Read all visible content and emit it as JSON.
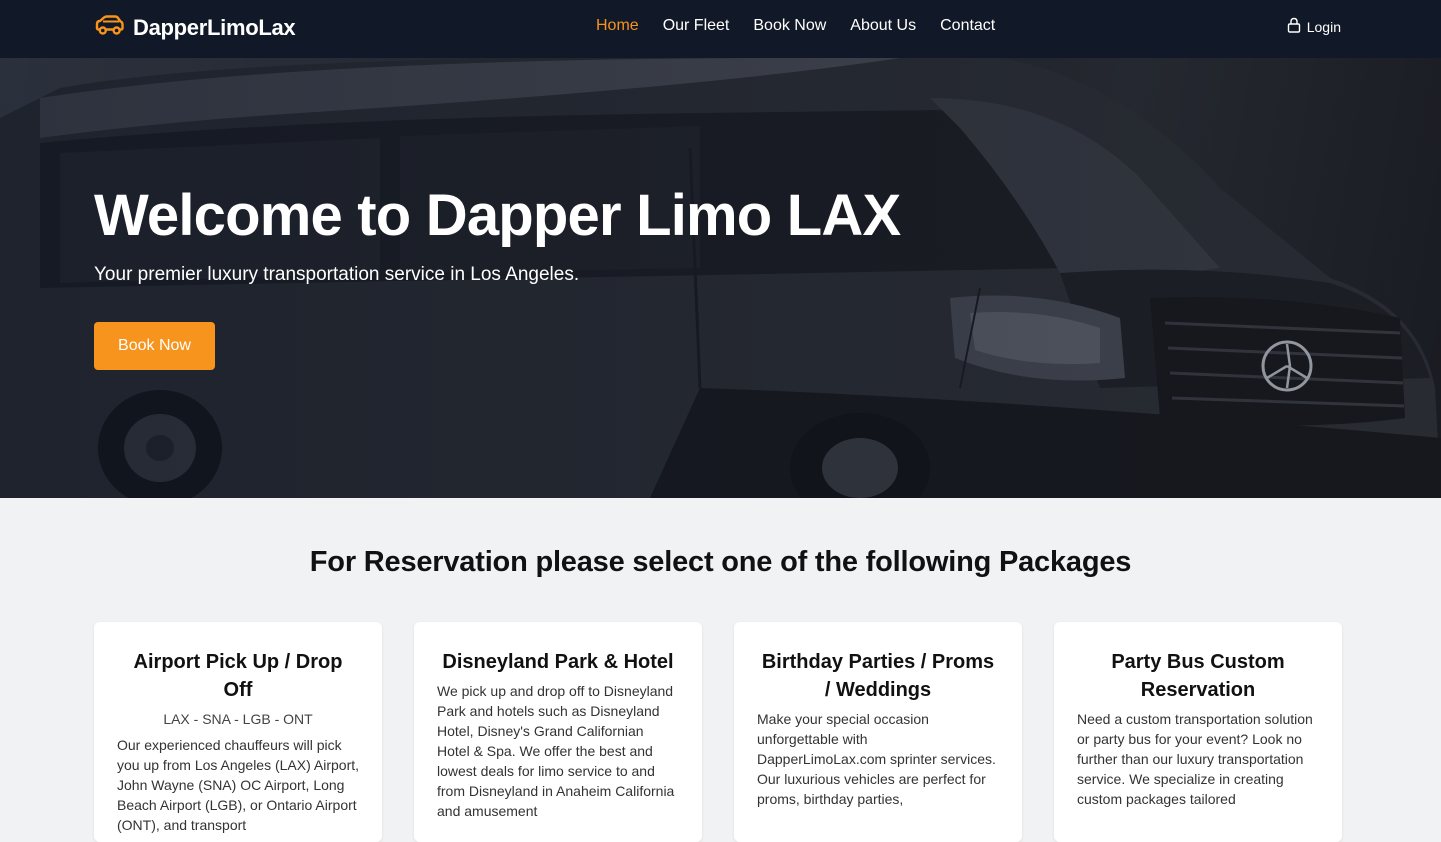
{
  "navbar": {
    "brand": "DapperLimoLax",
    "links": [
      "Home",
      "Our Fleet",
      "Book Now",
      "About Us",
      "Contact"
    ],
    "active": "Home",
    "login": "Login",
    "accent": "#f7941d",
    "brand_icon": "car-icon",
    "login_icon": "lock-icon"
  },
  "hero": {
    "title": "Welcome to Dapper Limo LAX",
    "subtitle": "Your premier luxury transportation service in Los Angeles.",
    "button": "Book Now"
  },
  "packages": {
    "heading": "For Reservation please select one of the following Packages",
    "cards": [
      {
        "title": "Airport Pick Up / Drop Off",
        "subtitle": "LAX - SNA - LGB - ONT",
        "description": "Our experienced chauffeurs will pick you up from Los Angeles (LAX) Airport, John Wayne (SNA) OC Airport, Long Beach Airport (LGB), or Ontario Airport (ONT), and transport"
      },
      {
        "title": "Disneyland Park & Hotel",
        "subtitle": "",
        "description": "We pick up and drop off to Disneyland Park and hotels such as Disneyland Hotel, Disney's Grand Californian Hotel & Spa. We offer the best and lowest deals for limo service to and from Disneyland in Anaheim California and amusement"
      },
      {
        "title": "Birthday Parties / Proms / Weddings",
        "subtitle": "",
        "description": "Make your special occasion unforgettable with DapperLimoLax.com sprinter services. Our luxurious vehicles are perfect for proms, birthday parties,"
      },
      {
        "title": "Party Bus Custom Reservation",
        "subtitle": "",
        "description": "Need a custom transportation solution or party bus for your event? Look no further than our luxury transportation service. We specialize in creating custom packages tailored"
      }
    ]
  }
}
